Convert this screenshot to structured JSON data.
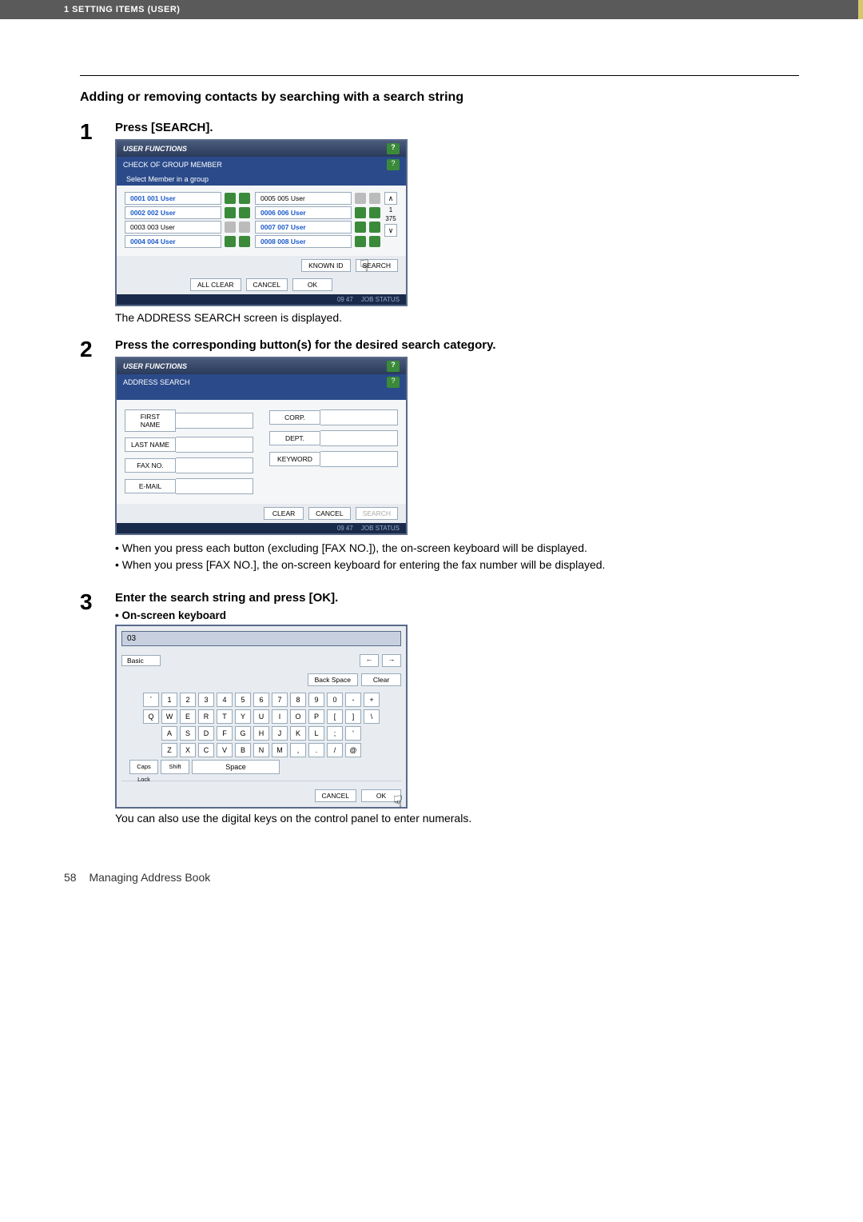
{
  "header": {
    "chapter": "1 SETTING ITEMS (USER)"
  },
  "section_title": "Adding or removing contacts by searching with a search string",
  "steps": {
    "s1": {
      "num": "1",
      "head": "Press [SEARCH].",
      "shot": {
        "win_title": "USER FUNCTIONS",
        "subbar": "CHECK OF GROUP MEMBER",
        "strip": "Select Member in a group",
        "rows_left": [
          {
            "id": "0001",
            "name": "001 User",
            "sel": true
          },
          {
            "id": "0002",
            "name": "002 User",
            "sel": true
          },
          {
            "id": "0003",
            "name": "003 User",
            "sel": false
          },
          {
            "id": "0004",
            "name": "004 User",
            "sel": true
          }
        ],
        "rows_right": [
          {
            "id": "0005",
            "name": "005 User",
            "sel": false
          },
          {
            "id": "0006",
            "name": "006 User",
            "sel": true
          },
          {
            "id": "0007",
            "name": "007 User",
            "sel": true
          },
          {
            "id": "0008",
            "name": "008 User",
            "sel": true
          }
        ],
        "scroll": {
          "top": "1",
          "total": "375"
        },
        "btns1": {
          "known_id": "KNOWN ID",
          "search": "SEARCH"
        },
        "btns2": {
          "all_clear": "ALL CLEAR",
          "cancel": "CANCEL",
          "ok": "OK"
        },
        "status": {
          "time": "09 47",
          "job": "JOB STATUS"
        }
      },
      "caption": "The ADDRESS SEARCH screen is displayed."
    },
    "s2": {
      "num": "2",
      "head": "Press the corresponding button(s) for the desired search category.",
      "shot": {
        "win_title": "USER FUNCTIONS",
        "subbar": "ADDRESS SEARCH",
        "fields_left": [
          "FIRST NAME",
          "LAST NAME",
          "FAX NO.",
          "E-MAIL"
        ],
        "fields_right": [
          "CORP.",
          "DEPT.",
          "KEYWORD"
        ],
        "btns": {
          "clear": "CLEAR",
          "cancel": "CANCEL",
          "search": "SEARCH"
        },
        "status": {
          "time": "09 47",
          "job": "JOB STATUS"
        }
      },
      "notes": [
        "When you press each button (excluding [FAX NO.]), the on-screen keyboard will be displayed.",
        "When you press [FAX NO.], the on-screen keyboard for entering the fax number will be displayed."
      ]
    },
    "s3": {
      "num": "3",
      "head": "Enter the search string and press [OK].",
      "sub_head": "On-screen keyboard",
      "shot": {
        "input_value": "03",
        "mode": "Basic",
        "nav": {
          "back": "←",
          "fwd": "→",
          "backspace": "Back Space",
          "clear": "Clear"
        },
        "row1": [
          "`",
          "1",
          "2",
          "3",
          "4",
          "5",
          "6",
          "7",
          "8",
          "9",
          "0",
          "-",
          "+"
        ],
        "row2": [
          "Q",
          "W",
          "E",
          "R",
          "T",
          "Y",
          "U",
          "I",
          "O",
          "P",
          "[",
          "]",
          "\\"
        ],
        "row3": [
          "A",
          "S",
          "D",
          "F",
          "G",
          "H",
          "J",
          "K",
          "L",
          ";",
          "'"
        ],
        "row4": [
          "Z",
          "X",
          "C",
          "V",
          "B",
          "N",
          "M",
          ",",
          ".",
          "/",
          "@"
        ],
        "row5": {
          "caps": "Caps Lock",
          "shift": "Shift",
          "space": "Space"
        },
        "btns": {
          "cancel": "CANCEL",
          "ok": "OK"
        }
      },
      "caption": "You can also use the digital keys on the control panel to enter numerals."
    }
  },
  "footer": {
    "page": "58",
    "title": "Managing Address Book"
  }
}
